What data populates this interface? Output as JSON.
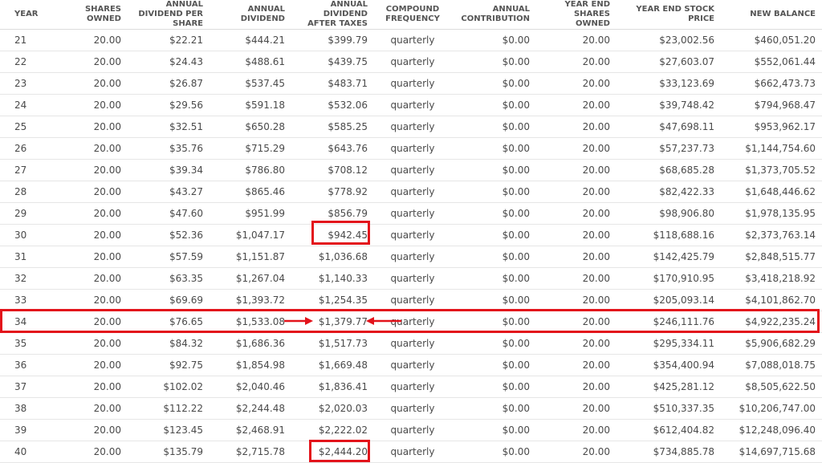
{
  "columns": [
    "YEAR",
    "SHARES OWNED",
    "ANNUAL DIVIDEND PER SHARE",
    "ANNUAL DIVIDEND",
    "ANNUAL DIVIDEND AFTER TAXES",
    "COMPOUND FREQUENCY",
    "ANNUAL CONTRIBUTION",
    "YEAR END SHARES OWNED",
    "YEAR END STOCK PRICE",
    "NEW BALANCE"
  ],
  "rows": [
    [
      "21",
      "20.00",
      "$22.21",
      "$444.21",
      "$399.79",
      "quarterly",
      "$0.00",
      "20.00",
      "$23,002.56",
      "$460,051.20"
    ],
    [
      "22",
      "20.00",
      "$24.43",
      "$488.61",
      "$439.75",
      "quarterly",
      "$0.00",
      "20.00",
      "$27,603.07",
      "$552,061.44"
    ],
    [
      "23",
      "20.00",
      "$26.87",
      "$537.45",
      "$483.71",
      "quarterly",
      "$0.00",
      "20.00",
      "$33,123.69",
      "$662,473.73"
    ],
    [
      "24",
      "20.00",
      "$29.56",
      "$591.18",
      "$532.06",
      "quarterly",
      "$0.00",
      "20.00",
      "$39,748.42",
      "$794,968.47"
    ],
    [
      "25",
      "20.00",
      "$32.51",
      "$650.28",
      "$585.25",
      "quarterly",
      "$0.00",
      "20.00",
      "$47,698.11",
      "$953,962.17"
    ],
    [
      "26",
      "20.00",
      "$35.76",
      "$715.29",
      "$643.76",
      "quarterly",
      "$0.00",
      "20.00",
      "$57,237.73",
      "$1,144,754.60"
    ],
    [
      "27",
      "20.00",
      "$39.34",
      "$786.80",
      "$708.12",
      "quarterly",
      "$0.00",
      "20.00",
      "$68,685.28",
      "$1,373,705.52"
    ],
    [
      "28",
      "20.00",
      "$43.27",
      "$865.46",
      "$778.92",
      "quarterly",
      "$0.00",
      "20.00",
      "$82,422.33",
      "$1,648,446.62"
    ],
    [
      "29",
      "20.00",
      "$47.60",
      "$951.99",
      "$856.79",
      "quarterly",
      "$0.00",
      "20.00",
      "$98,906.80",
      "$1,978,135.95"
    ],
    [
      "30",
      "20.00",
      "$52.36",
      "$1,047.17",
      "$942.45",
      "quarterly",
      "$0.00",
      "20.00",
      "$118,688.16",
      "$2,373,763.14"
    ],
    [
      "31",
      "20.00",
      "$57.59",
      "$1,151.87",
      "$1,036.68",
      "quarterly",
      "$0.00",
      "20.00",
      "$142,425.79",
      "$2,848,515.77"
    ],
    [
      "32",
      "20.00",
      "$63.35",
      "$1,267.04",
      "$1,140.33",
      "quarterly",
      "$0.00",
      "20.00",
      "$170,910.95",
      "$3,418,218.92"
    ],
    [
      "33",
      "20.00",
      "$69.69",
      "$1,393.72",
      "$1,254.35",
      "quarterly",
      "$0.00",
      "20.00",
      "$205,093.14",
      "$4,101,862.70"
    ],
    [
      "34",
      "20.00",
      "$76.65",
      "$1,533.08",
      "$1,379.77",
      "quarterly",
      "$0.00",
      "20.00",
      "$246,111.76",
      "$4,922,235.24"
    ],
    [
      "35",
      "20.00",
      "$84.32",
      "$1,686.36",
      "$1,517.73",
      "quarterly",
      "$0.00",
      "20.00",
      "$295,334.11",
      "$5,906,682.29"
    ],
    [
      "36",
      "20.00",
      "$92.75",
      "$1,854.98",
      "$1,669.48",
      "quarterly",
      "$0.00",
      "20.00",
      "$354,400.94",
      "$7,088,018.75"
    ],
    [
      "37",
      "20.00",
      "$102.02",
      "$2,040.46",
      "$1,836.41",
      "quarterly",
      "$0.00",
      "20.00",
      "$425,281.12",
      "$8,505,622.50"
    ],
    [
      "38",
      "20.00",
      "$112.22",
      "$2,244.48",
      "$2,020.03",
      "quarterly",
      "$0.00",
      "20.00",
      "$510,337.35",
      "$10,206,747.00"
    ],
    [
      "39",
      "20.00",
      "$123.45",
      "$2,468.91",
      "$2,222.02",
      "quarterly",
      "$0.00",
      "20.00",
      "$612,404.82",
      "$12,248,096.40"
    ],
    [
      "40",
      "20.00",
      "$135.79",
      "$2,715.78",
      "$2,444.20",
      "quarterly",
      "$0.00",
      "20.00",
      "$734,885.78",
      "$14,697,715.68"
    ]
  ],
  "colors": {
    "highlight": "#e3131b"
  }
}
